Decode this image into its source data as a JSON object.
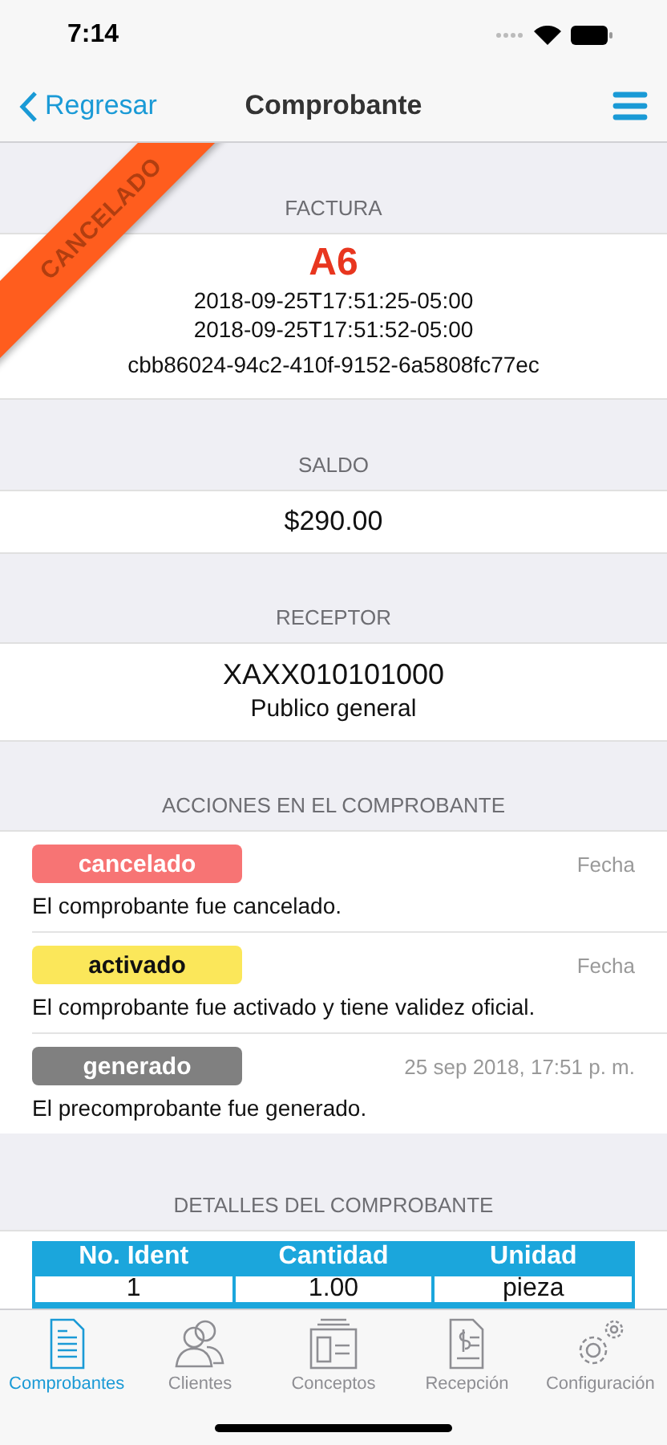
{
  "status_bar": {
    "time": "7:14"
  },
  "nav": {
    "back": "Regresar",
    "title": "Comprobante"
  },
  "ribbon": {
    "label": "CANCELADO"
  },
  "factura": {
    "heading": "FACTURA",
    "folio": "A6",
    "dates": [
      "2018-09-25T17:51:25-05:00",
      "2018-09-25T17:51:52-05:00"
    ],
    "uuid": "cbb86024-94c2-410f-9152-6a5808fc77ec"
  },
  "saldo": {
    "heading": "SALDO",
    "amount": "$290.00"
  },
  "receptor": {
    "heading": "RECEPTOR",
    "rfc": "XAXX010101000",
    "name": "Publico general"
  },
  "actions": {
    "heading": "ACCIONES EN EL COMPROBANTE",
    "items": [
      {
        "status": "cancelado",
        "color": "#f77474",
        "date": "Fecha",
        "description": "El comprobante fue cancelado."
      },
      {
        "status": "activado",
        "color": "#fbe75a",
        "date": "Fecha",
        "description": "El comprobante fue activado y tiene validez oficial."
      },
      {
        "status": "generado",
        "color": "#808080",
        "date": "25 sep 2018, 17:51 p. m.",
        "description": "El precomprobante fue generado."
      }
    ]
  },
  "details": {
    "heading": "DETALLES DEL COMPROBANTE",
    "columns": [
      "No. Ident",
      "Cantidad",
      "Unidad"
    ],
    "rows": [
      [
        "1",
        "1.00",
        "pieza"
      ]
    ]
  },
  "tabs": [
    {
      "label": "Comprobantes",
      "kind": "document",
      "selected": true
    },
    {
      "label": "Clientes",
      "kind": "people",
      "selected": false
    },
    {
      "label": "Conceptos",
      "kind": "layout",
      "selected": false
    },
    {
      "label": "Recepción",
      "kind": "receipt",
      "selected": false
    },
    {
      "label": "Configuración",
      "kind": "gears",
      "selected": false
    }
  ]
}
